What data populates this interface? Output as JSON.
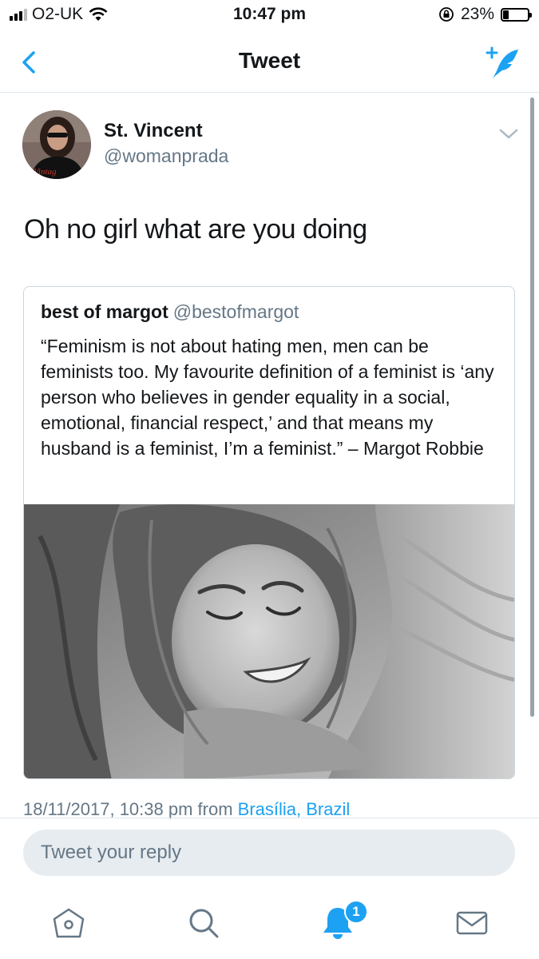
{
  "status_bar": {
    "carrier": "O2-UK",
    "time": "10:47 pm",
    "battery_percent_label": "23%",
    "battery_level": 0.23
  },
  "nav": {
    "title": "Tweet",
    "back_icon": "chevron-left-icon",
    "compose_icon": "compose-tweet-icon"
  },
  "tweet": {
    "author_name": "St. Vincent",
    "author_handle": "@womanprada",
    "text": "Oh no girl what are you doing",
    "timestamp": "18/11/2017, 10:38 pm from",
    "location": "Brasília, Brazil",
    "avatar_shirt_text": "Vintag"
  },
  "quoted_tweet": {
    "author_name": "best of margot",
    "author_handle": "@bestofmargot",
    "text": "“Feminism is not about hating men, men can be feminists too. My favourite definition of a feminist is ‘any person who believes in gender equality in a social, emotional, financial respect,’ and that means my husband is a feminist, I’m a feminist.” – Margot Robbie"
  },
  "reply": {
    "placeholder": "Tweet your reply"
  },
  "tabbar": {
    "items": [
      "home-icon",
      "search-icon",
      "notifications-icon",
      "messages-icon"
    ],
    "notification_count": "1"
  },
  "colors": {
    "accent": "#1da1f2",
    "secondary_text": "#657786",
    "border": "#e1e8ed"
  }
}
